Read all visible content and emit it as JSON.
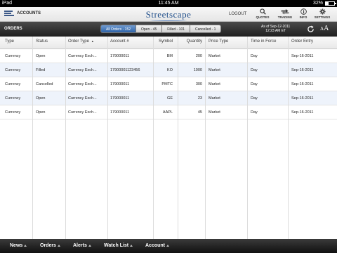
{
  "status_bar": {
    "device": "iPad",
    "time": "11:45 AM",
    "battery": "32%",
    "battery_level": 0.32
  },
  "app_bar": {
    "accounts_label": "ACCOUNTS",
    "logo": "Streetscape",
    "logout_label": "LOGOUT",
    "tools": [
      {
        "label": "QUOTES",
        "icon": "search-icon"
      },
      {
        "label": "TRADING",
        "icon": "trading-icon"
      },
      {
        "label": "INFO",
        "icon": "info-icon"
      },
      {
        "label": "SETTINGS",
        "icon": "gear-icon"
      }
    ]
  },
  "orders_bar": {
    "title": "ORDERS",
    "segments": [
      {
        "label": "All Orders - 152",
        "active": true
      },
      {
        "label": "Open - 45",
        "active": false
      },
      {
        "label": "Filled - 101",
        "active": false
      },
      {
        "label": "Cancelled - 1",
        "active": false
      }
    ],
    "as_of_line1": "As of Sep-12-2011",
    "as_of_line2": "12:23 AM ET",
    "font_icon_large": "A",
    "font_icon_small": "A"
  },
  "table": {
    "columns": [
      "Type",
      "Status",
      "Order Type",
      "Account #",
      "Symbol",
      "Quantity",
      "Price Type",
      "Time in Force",
      "Order Entry"
    ],
    "sort_indicator": "▲",
    "rows": [
      [
        "Currency",
        "Open",
        "Currency Exch...",
        "179000011",
        "BM",
        "200",
        "Market",
        "Day",
        "Sep-16-2011"
      ],
      [
        "Currency",
        "Filled",
        "Currency Exch...",
        "1790000112345​6",
        "KO",
        "1000",
        "Market",
        "Day",
        "Sep-16-2011"
      ],
      [
        "Currency",
        "Cancelled",
        "Currency Exch...",
        "179000011",
        "PMTC",
        "300",
        "Market",
        "Day",
        "Sep-16-2011"
      ],
      [
        "Currency",
        "Open",
        "Currency Exch...",
        "179000011",
        "GE",
        "23",
        "Market",
        "Day",
        "Sep-16-2011"
      ],
      [
        "Currency",
        "Open",
        "Currency Exch...",
        "179000011",
        "AAPL",
        "45",
        "Market",
        "Day",
        "Sep-16-2011"
      ]
    ]
  },
  "bottom_nav": [
    "News",
    "Orders",
    "Alerts",
    "Watch List",
    "Account"
  ]
}
